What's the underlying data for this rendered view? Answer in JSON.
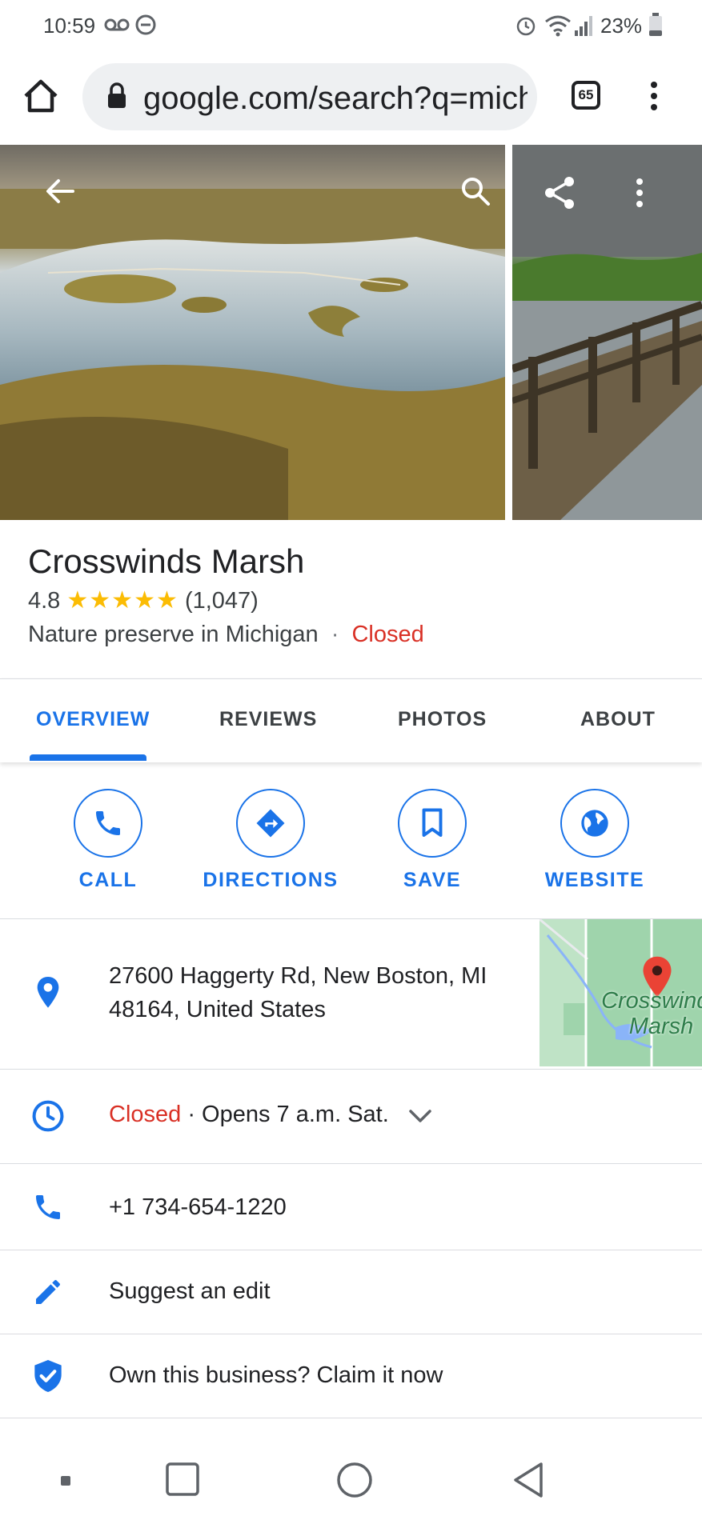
{
  "status_bar": {
    "time": "10:59",
    "battery": "23%"
  },
  "browser": {
    "url": "google.com/search?q=michi",
    "tab_count": "65"
  },
  "place": {
    "name": "Crosswinds Marsh",
    "rating": "4.8",
    "stars": "★★★★★",
    "review_count": "(1,047)",
    "category": "Nature preserve in Michigan",
    "separator": "·",
    "open_status": "Closed"
  },
  "tabs": [
    {
      "label": "OVERVIEW"
    },
    {
      "label": "REVIEWS"
    },
    {
      "label": "PHOTOS"
    },
    {
      "label": "ABOUT"
    }
  ],
  "actions": [
    {
      "label": "CALL"
    },
    {
      "label": "DIRECTIONS"
    },
    {
      "label": "SAVE"
    },
    {
      "label": "WEBSITE"
    }
  ],
  "info": {
    "address_line1": "27600 Haggerty Rd, New Boston, MI",
    "address_line2": "48164, United States",
    "map_label_line1": "Crosswinds",
    "map_label_line2": "Marsh",
    "hours_status": "Closed",
    "hours_detail": "· Opens 7 a.m. Sat.",
    "phone": "+1 734-654-1220",
    "suggest_edit": "Suggest an edit",
    "claim": "Own this business? Claim it now"
  },
  "colors": {
    "accent": "#1a73e8",
    "closed": "#d93025",
    "star": "#fbbc04",
    "pin": "#ea4335"
  }
}
